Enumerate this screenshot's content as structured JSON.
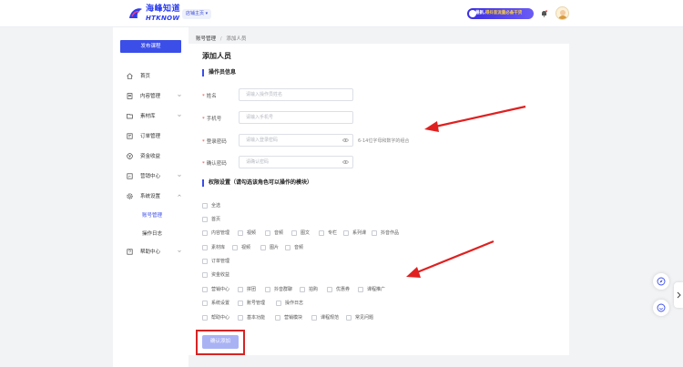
{
  "header": {
    "logo_text": "海峰知道",
    "logo_sub": "HTKNOW",
    "home_button": "店铺主页",
    "promo_prefix": "最新,",
    "promo_highlight": "得抖音流量必备干货"
  },
  "sidebar": {
    "publish_button": "发布课程",
    "items": [
      {
        "label": "首页",
        "icon": "home-icon"
      },
      {
        "label": "内容管理",
        "icon": "document-icon"
      },
      {
        "label": "素材库",
        "icon": "folder-icon"
      },
      {
        "label": "订单管理",
        "icon": "order-icon"
      },
      {
        "label": "资金收益",
        "icon": "coin-icon"
      },
      {
        "label": "营销中心",
        "icon": "marketing-icon"
      },
      {
        "label": "系统设置",
        "icon": "gear-icon"
      },
      {
        "label": "帮助中心",
        "icon": "help-icon"
      }
    ],
    "sub_items": [
      "账号管理",
      "操作日志"
    ]
  },
  "breadcrumb": {
    "parent": "账号管理",
    "separator": "/",
    "current": "添加人员"
  },
  "page_title": "添加人员",
  "operator_section": {
    "title": "操作员信息",
    "fields": [
      {
        "label": "姓名",
        "placeholder": "请输入操作员姓名"
      },
      {
        "label": "手机号",
        "placeholder": "请输入手机号"
      },
      {
        "label": "登录密码",
        "placeholder": "请输入登录密码"
      },
      {
        "label": "确认密码",
        "placeholder": "请确认密码"
      }
    ],
    "password_hint": "6-14位字母和数字的组合"
  },
  "permission_section": {
    "title": "权限设置（请勾选该角色可以操作的模块）",
    "rows": [
      [
        "全选"
      ],
      [
        "首页"
      ],
      [
        "内容管理",
        "视频",
        "音频",
        "图文",
        "专栏",
        "系列课",
        "抖音作品"
      ],
      [
        "素材库",
        "视频",
        "图片",
        "音频"
      ],
      [
        "订单管理"
      ],
      [
        "资金收益"
      ],
      [
        "营销中心",
        "拼团",
        "抖音群聊",
        "拍购",
        "优惠券",
        "课程推广"
      ],
      [
        "系统设置",
        "账号管理",
        "操作日志"
      ],
      [
        "帮助中心",
        "基本功能",
        "营销模块",
        "课程规范",
        "常见问题"
      ]
    ]
  },
  "submit_button": "确认添加",
  "colors": {
    "accent": "#3b4ee8",
    "annotation_red": "#d62424",
    "submit_disabled": "#a9b3f4"
  }
}
